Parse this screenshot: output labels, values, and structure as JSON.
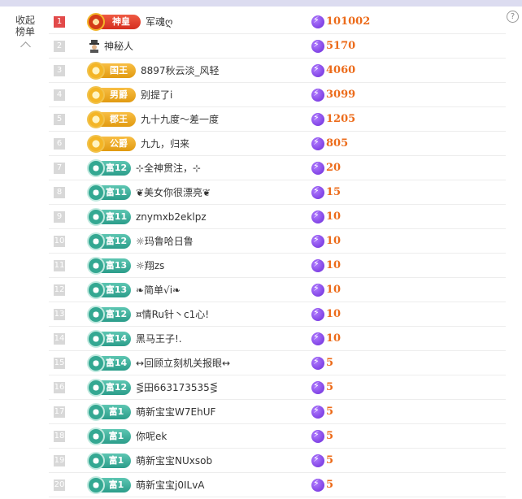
{
  "panel": {
    "collapse_label": "收起\n榜单",
    "help_label": "?"
  },
  "rows": [
    {
      "rank": "1",
      "badge": "神皇",
      "badge_type": "god",
      "name": "军魂ღ",
      "score": "101002"
    },
    {
      "rank": "2",
      "badge": "",
      "badge_type": "mystery",
      "name": "神秘人",
      "score": "5170"
    },
    {
      "rank": "3",
      "badge": "国王",
      "badge_type": "gold",
      "name": "8897秋云淡_风轻",
      "score": "4060"
    },
    {
      "rank": "4",
      "badge": "男爵",
      "badge_type": "gold",
      "name": "别提了i",
      "score": "3099"
    },
    {
      "rank": "5",
      "badge": "郡王",
      "badge_type": "gold",
      "name": "九十九度～差一度",
      "score": "1205"
    },
    {
      "rank": "6",
      "badge": "公爵",
      "badge_type": "gold",
      "name": "九九，归来",
      "score": "805"
    },
    {
      "rank": "7",
      "badge": "富12",
      "badge_type": "teal",
      "name": "⊹全神贯注，⊹",
      "score": "20"
    },
    {
      "rank": "8",
      "badge": "富11",
      "badge_type": "teal",
      "name": "❦美女你很漂亮❦",
      "score": "15"
    },
    {
      "rank": "9",
      "badge": "富11",
      "badge_type": "teal",
      "name": "znymxb2eklpz",
      "score": "10"
    },
    {
      "rank": "10",
      "badge": "富12",
      "badge_type": "teal",
      "name": "☼玛鲁哈日鲁",
      "score": "10"
    },
    {
      "rank": "11",
      "badge": "富13",
      "badge_type": "teal",
      "name": "☼翔zs",
      "score": "10"
    },
    {
      "rank": "12",
      "badge": "富13",
      "badge_type": "teal",
      "name": "❧简单√i❧",
      "score": "10"
    },
    {
      "rank": "13",
      "badge": "富12",
      "badge_type": "teal",
      "name": "¤情Ru针丶c1心!",
      "score": "10"
    },
    {
      "rank": "14",
      "badge": "富14",
      "badge_type": "teal",
      "name": "黑马王子!.",
      "score": "10"
    },
    {
      "rank": "15",
      "badge": "富14",
      "badge_type": "teal",
      "name": "↔回顾立刻机关报眼↔",
      "score": "5"
    },
    {
      "rank": "16",
      "badge": "富12",
      "badge_type": "teal",
      "name": "⋚田663173535⋚",
      "score": "5"
    },
    {
      "rank": "17",
      "badge": "富1",
      "badge_type": "teal",
      "name": "萌新宝宝W7EhUF",
      "score": "5"
    },
    {
      "rank": "18",
      "badge": "富1",
      "badge_type": "teal",
      "name": "你呢ek",
      "score": "5"
    },
    {
      "rank": "19",
      "badge": "富1",
      "badge_type": "teal",
      "name": "萌新宝宝NUxsob",
      "score": "5"
    },
    {
      "rank": "20",
      "badge": "富1",
      "badge_type": "teal",
      "name": "萌新宝宝j0ILvA",
      "score": "5"
    }
  ]
}
